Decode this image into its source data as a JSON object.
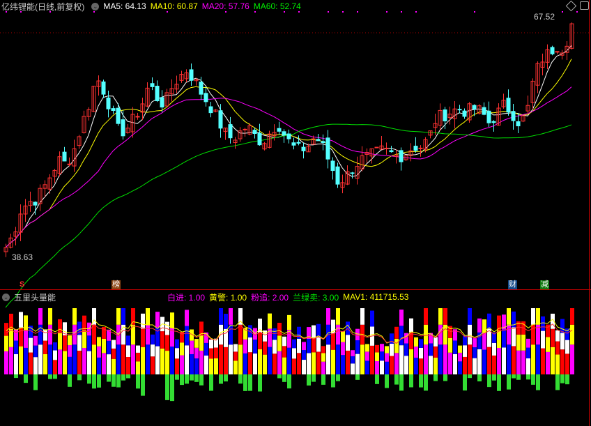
{
  "header": {
    "title": "亿纬锂能(日线,前复权)",
    "ma5": "MA5: 64.13",
    "ma10": "MA10: 60.87",
    "ma20": "MA20: 57.76",
    "ma60": "MA60: 52.74"
  },
  "volume_header": {
    "title": "五里头量能",
    "bai": "白进: 1.00",
    "huang": "黄警: 1.00",
    "fen": "粉追: 2.00",
    "lan": "兰绿卖: 3.00",
    "mav1": "MAV1: 411715.53"
  },
  "badges": {
    "s": "S",
    "bang": "榜",
    "cai": "财",
    "jian": "减"
  },
  "labels": {
    "high": "67.52",
    "low": "38.63"
  },
  "colors": {
    "up": "#ff3232",
    "down": "#54ffff",
    "ma5": "#ffffff",
    "ma10": "#ffff00",
    "ma20": "#ff00ff",
    "ma60": "#00e000"
  },
  "chart_data": {
    "type": "candlestick",
    "price_range": [
      38.63,
      67.52
    ],
    "close_keypoints": [
      39.9,
      41.5,
      44.5,
      45.3,
      45.7,
      47.0,
      48.7,
      50.4,
      49.9,
      51.6,
      54.5,
      57.0,
      60.4,
      58.7,
      56.2,
      53.7,
      54.1,
      55.4,
      57.0,
      59.6,
      57.9,
      57.0,
      59.1,
      60.4,
      61.2,
      60.0,
      58.3,
      57.0,
      55.4,
      53.7,
      52.9,
      53.7,
      54.5,
      53.3,
      52.5,
      53.7,
      54.9,
      53.3,
      52.0,
      51.6,
      52.0,
      53.3,
      52.0,
      49.9,
      47.8,
      48.3,
      49.5,
      50.4,
      50.8,
      51.2,
      51.6,
      51.2,
      50.8,
      51.2,
      52.0,
      52.0,
      52.9,
      55.4,
      55.8,
      56.2,
      56.6,
      56.2,
      56.6,
      56.2,
      54.9,
      55.8,
      57.0,
      56.2,
      54.9,
      55.8,
      60.4,
      62.5,
      63.3,
      64.2,
      63.8,
      66.7
    ],
    "candle_count": 117,
    "ma_periods": [
      5,
      10,
      20,
      60
    ]
  }
}
